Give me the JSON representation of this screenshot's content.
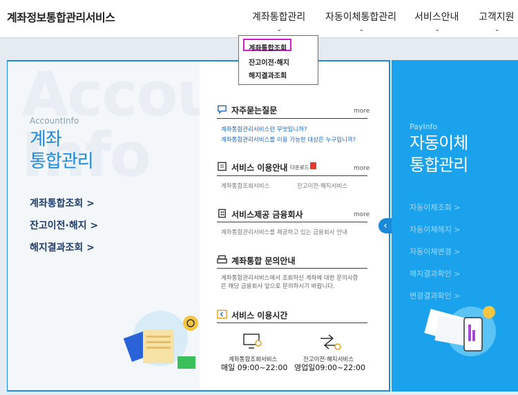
{
  "header": {
    "logo": "계좌정보통합관리서비스",
    "nav": [
      {
        "label": "계좌통합관리"
      },
      {
        "label": "자동이체통합관리"
      },
      {
        "label": "서비스안내"
      },
      {
        "label": "고객지원"
      }
    ]
  },
  "dropdown": {
    "items": [
      "계좌통합조회",
      "잔고이전·해지",
      "해지결과조회"
    ]
  },
  "left": {
    "watermark1": "Account",
    "watermark2": "Info",
    "eng": "AccountInfo",
    "title1": "계좌",
    "title2": "통합관리",
    "links": [
      "계좌통합조회 >",
      "잔고이전·해지 >",
      "해지결과조회 >"
    ]
  },
  "sections": {
    "faq": {
      "title": "자주묻는질문",
      "more": "more",
      "q1": "계좌통합관리서비스란 무엇입니까?",
      "q2": "계좌통합관리서비스를 이용 가능한 대상은 누구입니까?"
    },
    "guide": {
      "title": "서비스 이용안내",
      "download": "다운로드",
      "more": "more",
      "item1": "계좌통합조회서비스",
      "item2": "잔고이전·해지서비스"
    },
    "companies": {
      "title": "서비스제공 금융회사",
      "more": "more",
      "desc": "계좌통합관리서비스를 제공하고 있는 금융회사 안내"
    },
    "inquiry": {
      "title": "계좌통합 문의안내",
      "desc1": "계좌통합관리서비스에서 조회하신 계좌에 대한 문의사항",
      "desc2": "은 해당 금융회사 앞으로 문의하시기 바랍니다."
    },
    "hours": {
      "title": "서비스 이용시간",
      "svc1": "계좌통합조회서비스",
      "time1": "매일 09:00~22:00",
      "svc2": "잔고이전·해지서비스",
      "time2": "영업일09:00~22:00"
    }
  },
  "right": {
    "eng": "PayInfo",
    "title1": "자동이체",
    "title2": "통합관리",
    "links": [
      "자동이체조회 >",
      "자동이체해지 >",
      "자동이체변경 >",
      "해지결과확인 >",
      "변경결과확인 >"
    ]
  },
  "colors": {
    "accent": "#1b8be0",
    "right_bg": "#1aa3ec",
    "highlight": "#d11ad0"
  }
}
